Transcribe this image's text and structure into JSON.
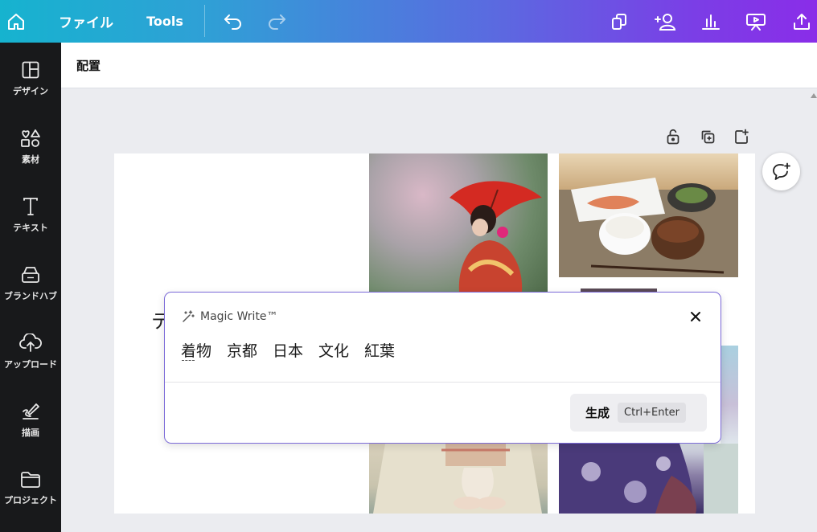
{
  "topbar": {
    "file_label": "ファイル",
    "tools_label": "Tools",
    "icons": [
      "home-icon",
      "undo-icon",
      "redo-icon",
      "resize-icon",
      "share-people-icon",
      "insights-icon",
      "present-icon",
      "upload-share-icon"
    ]
  },
  "sidebar": {
    "items": [
      {
        "label": "デザイン",
        "icon": "layout-icon"
      },
      {
        "label": "素材",
        "icon": "elements-icon"
      },
      {
        "label": "テキスト",
        "icon": "text-icon"
      },
      {
        "label": "ブランドハブ",
        "icon": "brand-icon"
      },
      {
        "label": "アップロード",
        "icon": "upload-icon"
      },
      {
        "label": "描画",
        "icon": "draw-icon"
      },
      {
        "label": "プロジェクト",
        "icon": "folder-icon"
      }
    ]
  },
  "subheader": {
    "title": "配置"
  },
  "page": {
    "partial_text": "テ"
  },
  "magic_write": {
    "title": "Magic Write™",
    "prompt_text": "着物　京都　日本　文化　紅葉",
    "generate_label": "生成",
    "shortcut_label": "Ctrl+Enter"
  },
  "colors": {
    "topbar_start": "#16b3cf",
    "topbar_end": "#8a2de8",
    "sidebar_bg": "#18191b",
    "dialog_border": "#7b6ad8"
  }
}
